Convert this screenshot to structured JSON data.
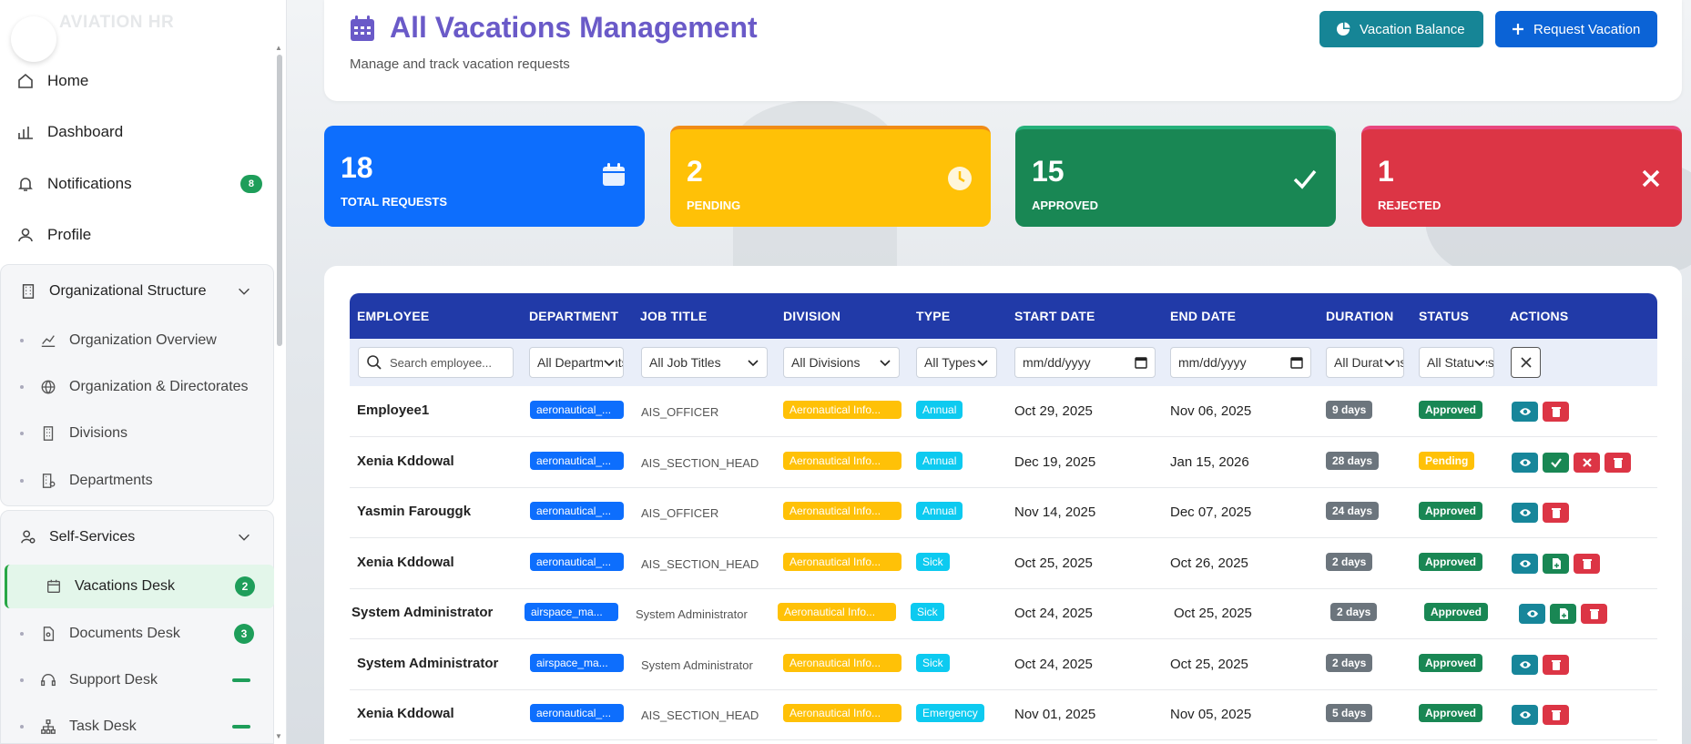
{
  "app": {
    "logo_text": "AVIATION HR"
  },
  "sidebar": {
    "items": [
      {
        "label": "Home"
      },
      {
        "label": "Dashboard"
      },
      {
        "label": "Notifications",
        "badge": "8"
      },
      {
        "label": "Profile"
      }
    ],
    "org_group": {
      "label": "Organizational Structure",
      "items": [
        {
          "label": "Organization Overview"
        },
        {
          "label": "Organization & Directorates"
        },
        {
          "label": "Divisions"
        },
        {
          "label": "Departments"
        }
      ]
    },
    "self_group": {
      "label": "Self-Services",
      "items": [
        {
          "label": "Vacations Desk",
          "badge": "2"
        },
        {
          "label": "Documents Desk",
          "badge": "3"
        },
        {
          "label": "Support Desk"
        },
        {
          "label": "Task Desk"
        }
      ]
    }
  },
  "header": {
    "title": "All Vacations Management",
    "subtitle": "Manage and track vacation requests",
    "btn_balance": "Vacation Balance",
    "btn_request": "Request Vacation"
  },
  "stats": [
    {
      "value": "18",
      "label": "TOTAL REQUESTS"
    },
    {
      "value": "2",
      "label": "PENDING"
    },
    {
      "value": "15",
      "label": "APPROVED"
    },
    {
      "value": "1",
      "label": "REJECTED"
    }
  ],
  "table": {
    "columns": [
      "EMPLOYEE",
      "DEPARTMENT",
      "JOB TITLE",
      "DIVISION",
      "TYPE",
      "START DATE",
      "END DATE",
      "DURATION",
      "STATUS",
      "ACTIONS"
    ],
    "filters": {
      "search_placeholder": "Search employee...",
      "department": "All Departments",
      "job_title": "All Job Titles",
      "division": "All Divisions",
      "type": "All Types",
      "start_date": "mm/dd/yyyy",
      "end_date": "mm/dd/yyyy",
      "duration": "All Durations",
      "status": "All Statuses"
    },
    "rows": [
      {
        "employee": "Employee1",
        "department": "aeronautical_...",
        "job_title": "AIS_OFFICER",
        "division": "Aeronautical Info...",
        "type": "Annual",
        "start": "Oct 29, 2025",
        "end": "Nov 06, 2025",
        "duration": "9 days",
        "status": "Approved"
      },
      {
        "employee": "Xenia Kddowal",
        "department": "aeronautical_...",
        "job_title": "AIS_SECTION_HEAD",
        "division": "Aeronautical Info...",
        "type": "Annual",
        "start": "Dec 19, 2025",
        "end": "Jan 15, 2026",
        "duration": "28 days",
        "status": "Pending"
      },
      {
        "employee": "Yasmin Farouggk",
        "department": "aeronautical_...",
        "job_title": "AIS_OFFICER",
        "division": "Aeronautical Info...",
        "type": "Annual",
        "start": "Nov 14, 2025",
        "end": "Dec 07, 2025",
        "duration": "24 days",
        "status": "Approved"
      },
      {
        "employee": "Xenia Kddowal",
        "department": "aeronautical_...",
        "job_title": "AIS_SECTION_HEAD",
        "division": "Aeronautical Info...",
        "type": "Sick",
        "start": "Oct 25, 2025",
        "end": "Oct 26, 2025",
        "duration": "2 days",
        "status": "Approved"
      },
      {
        "employee": "System Administrator",
        "department": "airspace_ma...",
        "job_title": "System Administrator",
        "division": "Aeronautical Info...",
        "type": "Sick",
        "start": "Oct 24, 2025",
        "end": "Oct 25, 2025",
        "duration": "2 days",
        "status": "Approved"
      },
      {
        "employee": "System Administrator",
        "department": "airspace_ma...",
        "job_title": "System Administrator",
        "division": "Aeronautical Info...",
        "type": "Sick",
        "start": "Oct 24, 2025",
        "end": "Oct 25, 2025",
        "duration": "2 days",
        "status": "Approved"
      },
      {
        "employee": "Xenia Kddowal",
        "department": "aeronautical_...",
        "job_title": "AIS_SECTION_HEAD",
        "division": "Aeronautical Info...",
        "type": "Emergency",
        "start": "Nov 01, 2025",
        "end": "Nov 05, 2025",
        "duration": "5 days",
        "status": "Approved"
      }
    ]
  }
}
